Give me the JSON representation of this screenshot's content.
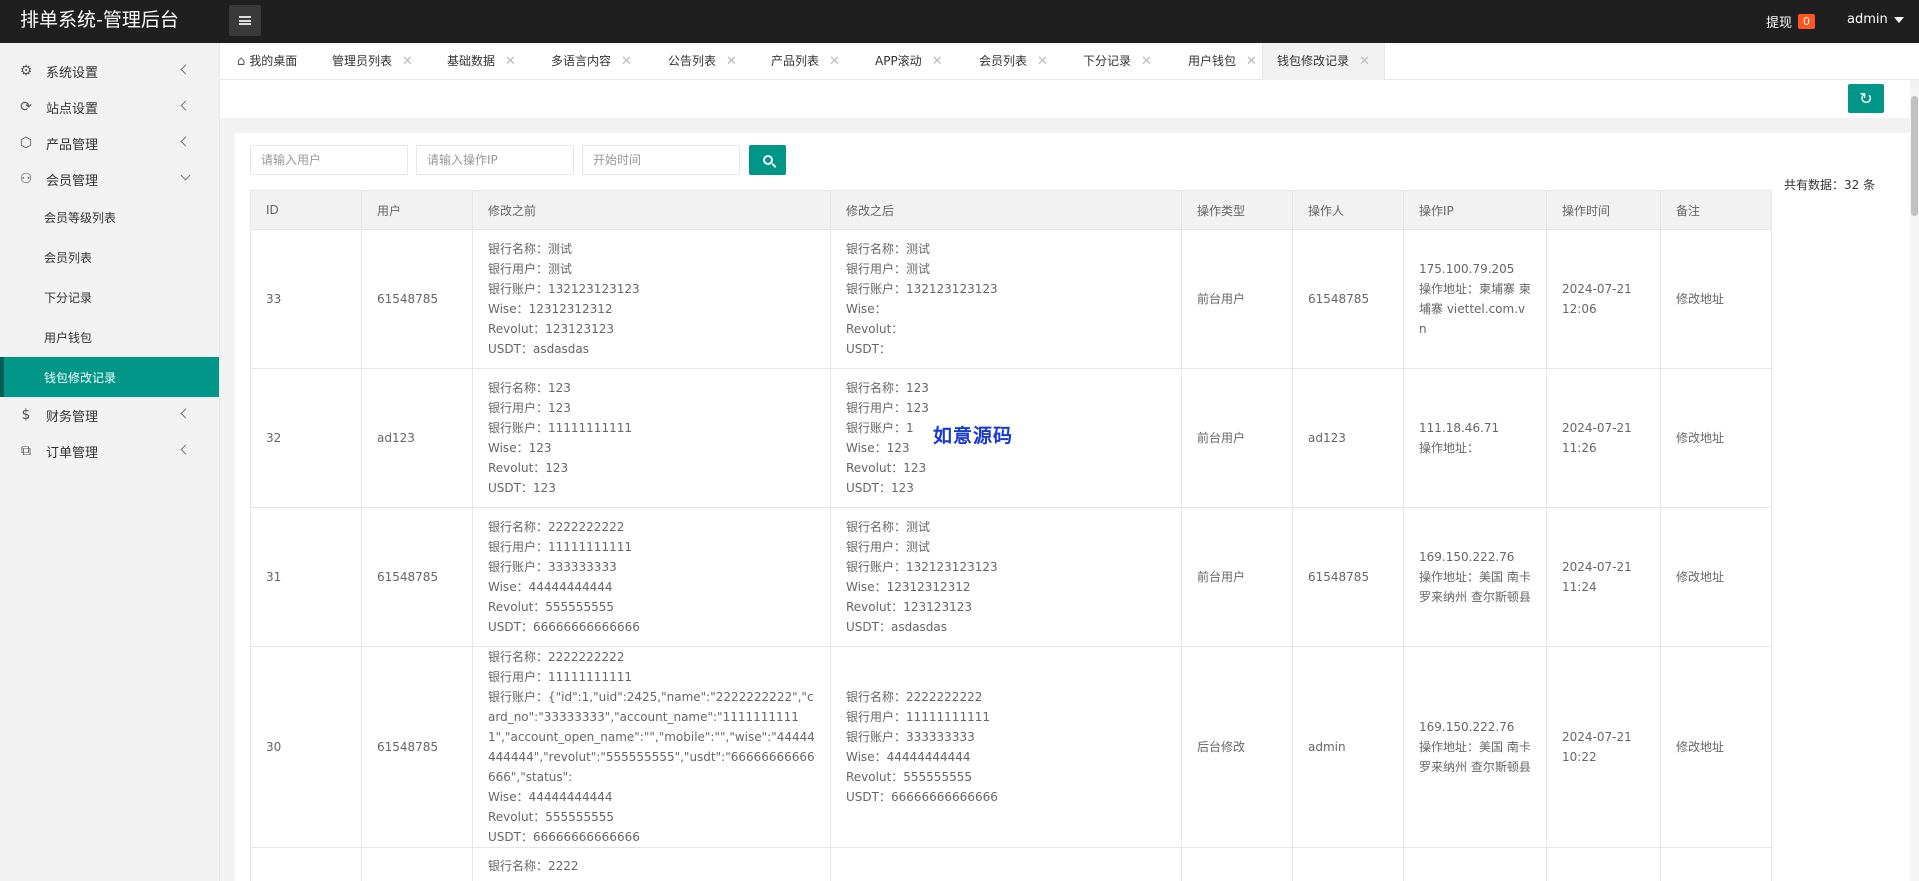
{
  "app": {
    "title": "排单系统-管理后台"
  },
  "header": {
    "withdraw_label": "提现",
    "withdraw_count": "0",
    "user_name": "admin"
  },
  "sidebar": {
    "items": [
      {
        "label": "系统设置",
        "icon": "gear-icon",
        "expanded": false
      },
      {
        "label": "站点设置",
        "icon": "refresh-icon",
        "expanded": false
      },
      {
        "label": "产品管理",
        "icon": "box-icon",
        "expanded": false
      },
      {
        "label": "会员管理",
        "icon": "user-icon",
        "expanded": true,
        "children": [
          "会员等级列表",
          "会员列表",
          "下分记录",
          "用户钱包",
          "钱包修改记录"
        ]
      },
      {
        "label": "财务管理",
        "icon": "dollar-icon",
        "expanded": false
      },
      {
        "label": "订单管理",
        "icon": "cubes-icon",
        "expanded": false
      }
    ],
    "active_child": "钱包修改记录"
  },
  "tabs": [
    "我的桌面",
    "管理员列表",
    "基础数据",
    "多语言内容",
    "公告列表",
    "产品列表",
    "APP滚动",
    "会员列表",
    "下分记录",
    "用户钱包",
    "钱包修改记录"
  ],
  "active_tab": "钱包修改记录",
  "search": {
    "user_placeholder": "请输入用户",
    "ip_placeholder": "请输入操作IP",
    "time_placeholder": "开始时间"
  },
  "total_text": "共有数据：32 条",
  "table": {
    "columns": [
      "ID",
      "用户",
      "修改之前",
      "修改之后",
      "操作类型",
      "操作人",
      "操作IP",
      "操作时间",
      "备注"
    ],
    "rows": [
      {
        "id": "33",
        "user": "61548785",
        "before": [
          "银行名称：测试",
          "银行用户：测试",
          "银行账户：132123123123",
          "Wise：12312312312",
          "Revolut：123123123",
          "USDT：asdasdas"
        ],
        "after": [
          "银行名称：测试",
          "银行用户：测试",
          "银行账户：132123123123",
          "Wise：",
          "Revolut：",
          "USDT："
        ],
        "type": "前台用户",
        "operator": "61548785",
        "ip": [
          "175.100.79.205",
          "操作地址：柬埔寨 柬埔寨 viettel.com.vn"
        ],
        "time": "2024-07-21 12:06",
        "remark": "修改地址"
      },
      {
        "id": "32",
        "user": "ad123",
        "before": [
          "银行名称：123",
          "银行用户：123",
          "银行账户：11111111111",
          "Wise：123",
          "Revolut：123",
          "USDT：123"
        ],
        "after": [
          "银行名称：123",
          "银行用户：123",
          "银行账户：1",
          "Wise：123",
          "Revolut：123",
          "USDT：123"
        ],
        "type": "前台用户",
        "operator": "ad123",
        "ip": [
          "111.18.46.71",
          "操作地址："
        ],
        "time": "2024-07-21 11:26",
        "remark": "修改地址"
      },
      {
        "id": "31",
        "user": "61548785",
        "before": [
          "银行名称：2222222222",
          "银行用户：11111111111",
          "银行账户：333333333",
          "Wise：44444444444",
          "Revolut：555555555",
          "USDT：66666666666666"
        ],
        "after": [
          "银行名称：测试",
          "银行用户：测试",
          "银行账户：132123123123",
          "Wise：12312312312",
          "Revolut：123123123",
          "USDT：asdasdas"
        ],
        "type": "前台用户",
        "operator": "61548785",
        "ip": [
          "169.150.222.76",
          "操作地址：美国 南卡罗来纳州 查尔斯顿县"
        ],
        "time": "2024-07-21 11:24",
        "remark": "修改地址"
      },
      {
        "id": "30",
        "user": "61548785",
        "before": [
          "银行名称：2222222222",
          "银行用户：11111111111",
          "银行账户：{\"id\":1,\"uid\":2425,\"name\":\"2222222222\",\"card_no\":\"33333333\",\"account_name\":\"11111111111\",\"account_open_name\":\"\",\"mobile\":\"\",\"wise\":\"44444444444\",\"revolut\":\"555555555\",\"usdt\":\"66666666666666\",\"status\":",
          "Wise：44444444444",
          "Revolut：555555555",
          "USDT：66666666666666"
        ],
        "after": [
          "银行名称：2222222222",
          "银行用户：11111111111",
          "银行账户：333333333",
          "Wise：44444444444",
          "Revolut：555555555",
          "USDT：66666666666666"
        ],
        "type": "后台修改",
        "operator": "admin",
        "ip": [
          "169.150.222.76",
          "操作地址：美国 南卡罗来纳州 查尔斯顿县"
        ],
        "time": "2024-07-21 10:22",
        "remark": "修改地址"
      },
      {
        "id": "",
        "user": "",
        "before": [
          "银行名称：2222"
        ],
        "after": [],
        "type": "",
        "operator": "",
        "ip": [],
        "time": "",
        "remark": ""
      }
    ]
  },
  "watermark": "如意源码",
  "colors": {
    "primary": "#009688",
    "topbar": "#1f1f1f",
    "badge": "#ff5722"
  }
}
